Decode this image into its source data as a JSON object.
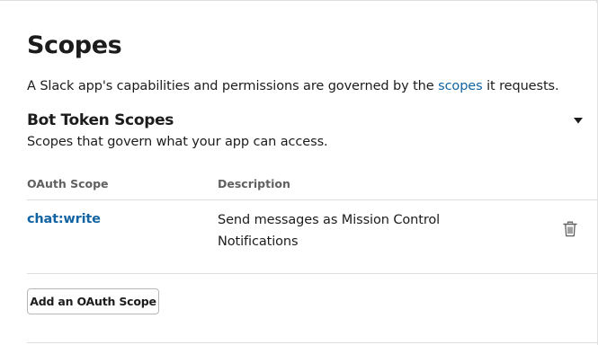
{
  "scopes_section": {
    "title": "Scopes",
    "intro_before": "A Slack app's capabilities and permissions are governed by the ",
    "intro_link": "scopes",
    "intro_after": " it requests."
  },
  "bot_token": {
    "title": "Bot Token Scopes",
    "subtitle": "Scopes that govern what your app can access.",
    "collapse_icon": "caret-down-icon"
  },
  "table": {
    "headers": [
      "OAuth Scope",
      "Description"
    ],
    "rows": [
      {
        "scope": "chat:write",
        "description": "Send messages as Mission Control Notifications",
        "action_icon": "trash-icon"
      }
    ]
  },
  "add_button_label": "Add an OAuth Scope",
  "colors": {
    "link": "#1264a3",
    "text": "#1d1c1d",
    "muted": "#616061",
    "divider": "#dddddd"
  }
}
